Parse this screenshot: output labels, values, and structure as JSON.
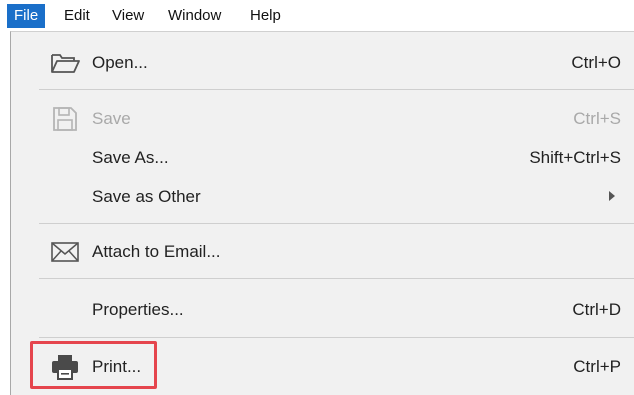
{
  "menubar": {
    "file": "File",
    "edit": "Edit",
    "view": "View",
    "window": "Window",
    "help": "Help"
  },
  "menu": {
    "open": {
      "label": "Open...",
      "shortcut": "Ctrl+O",
      "icon": "folder-open-icon"
    },
    "save": {
      "label": "Save",
      "shortcut": "Ctrl+S",
      "icon": "floppy-disk-icon"
    },
    "save_as": {
      "label": "Save As...",
      "shortcut": "Shift+Ctrl+S"
    },
    "save_as_other": {
      "label": "Save as Other"
    },
    "attach": {
      "label": "Attach to Email...",
      "icon": "envelope-icon"
    },
    "properties": {
      "label": "Properties...",
      "shortcut": "Ctrl+D"
    },
    "print": {
      "label": "Print...",
      "shortcut": "Ctrl+P",
      "icon": "printer-icon"
    }
  },
  "colors": {
    "active_menu": "#1a6fc9",
    "highlight_box": "#e5454d"
  }
}
